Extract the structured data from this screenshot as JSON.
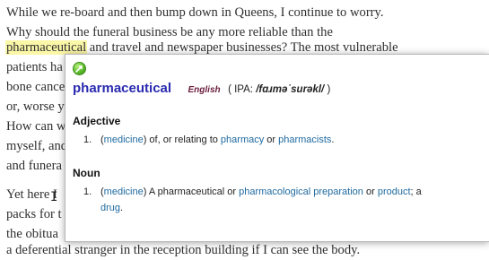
{
  "article": {
    "line1": "While we re-board and then bump down in Queens, I continue to worry.",
    "line2": "Why should the funeral business be any more reliable than the",
    "line3_highlight": "pharmaceutical",
    "line3_rest": " and travel and newspaper businesses? The most vulnerable",
    "line4": "patients ha",
    "line5": "bone cance",
    "line6": "or, worse y",
    "line7": "How can w",
    "line8": "myself, and",
    "line9": "and funera",
    "line10": "Yet here I",
    "line11": "packs for t",
    "line12": "the obitua",
    "line13": "a deferential stranger in the reception building if I can see the body."
  },
  "popup": {
    "headword": "pharmaceutical",
    "language": "English",
    "ipa_open": "( IPA: ",
    "ipa_value": "/fɑɹmə˙surəkl/",
    "ipa_close": " )",
    "sections": [
      {
        "pos": "Adjective",
        "senses": [
          {
            "num": "1.",
            "open_paren": "(",
            "label": "medicine",
            "close_paren": ")",
            "t1": " of, or relating to ",
            "link1": "pharmacy",
            "t2": " or ",
            "link2": "pharmacists",
            "t3": "."
          }
        ]
      },
      {
        "pos": "Noun",
        "senses": [
          {
            "num": "1.",
            "open_paren": "(",
            "label": "medicine",
            "close_paren": ")",
            "t1": " A pharmaceutical or ",
            "link1": "pharmacological preparation",
            "t2": " or ",
            "link2": "product",
            "t3": "; a",
            "link3": "drug",
            "t4": "."
          }
        ]
      }
    ],
    "icon": "dictionary-source-icon"
  },
  "colors": {
    "headword": "#2a2ab0",
    "link": "#1f6aa0",
    "language": "#6a1c3c",
    "highlight": "#fbf7a8"
  }
}
